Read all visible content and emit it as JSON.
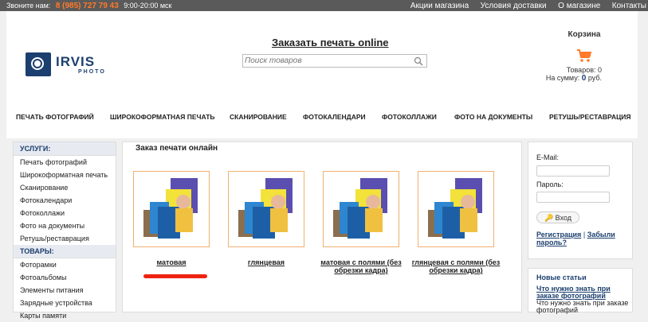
{
  "topbar": {
    "call_label": "Звоните нам:",
    "phone": "8 (985) 727 79 43",
    "hours": "9:00-20:00 мск",
    "links": [
      "Акции магазина",
      "Условия доставки",
      "О магазине",
      "Контакты"
    ]
  },
  "header": {
    "logo_name": "IRVIS",
    "logo_sub": "PHOTO",
    "order_title": "Заказать печать online",
    "search_placeholder": "Поиск товаров"
  },
  "cart": {
    "title": "Корзина",
    "items_line": "Товаров: 0",
    "sum_label": "На сумму:",
    "sum_value": "0",
    "currency": "руб."
  },
  "mainnav": [
    "ПЕЧАТЬ ФОТОГРАФИЙ",
    "ШИРОКОФОРМАТНАЯ ПЕЧАТЬ",
    "СКАНИРОВАНИЕ",
    "ФОТОКАЛЕНДАРИ",
    "ФОТОКОЛЛАЖИ",
    "ФОТО НА ДОКУМЕНТЫ",
    "РЕТУШЬ/РЕСТАВРАЦИЯ"
  ],
  "sidebar": {
    "services_title": "УСЛУГИ:",
    "services": [
      "Печать фотографий",
      "Широкоформатная печать",
      "Сканирование",
      "Фотокалендари",
      "Фотоколлажи",
      "Фото на документы",
      "Ретушь/реставрация"
    ],
    "goods_title": "ТОВАРЫ:",
    "goods": [
      "Фоторамки",
      "Фотоальбомы",
      "Элементы питания",
      "Зарядные устройства",
      "Карты памяти"
    ]
  },
  "content": {
    "title": "Заказ печати онлайн",
    "cards": [
      {
        "label": "матовая"
      },
      {
        "label": "глянцевая"
      },
      {
        "label": "матовая с полями (без обрезки кадра)"
      },
      {
        "label": "глянцевая с полями (без обрезки кадра)"
      }
    ]
  },
  "login": {
    "email_label": "E-Mail:",
    "password_label": "Пароль:",
    "button": "Вход",
    "register": "Регистрация",
    "separator": "|",
    "forgot": "Забыли пароль?"
  },
  "articles": {
    "title": "Новые статьи",
    "link": "Что нужно знать при заказе фотографий",
    "excerpt": "Что нужно знать при заказе фотографий"
  },
  "colors": {
    "accent": "#1b3f6e",
    "phone": "#ff7a2a",
    "topbar": "#5a5a5a",
    "annotation": "#e21"
  }
}
